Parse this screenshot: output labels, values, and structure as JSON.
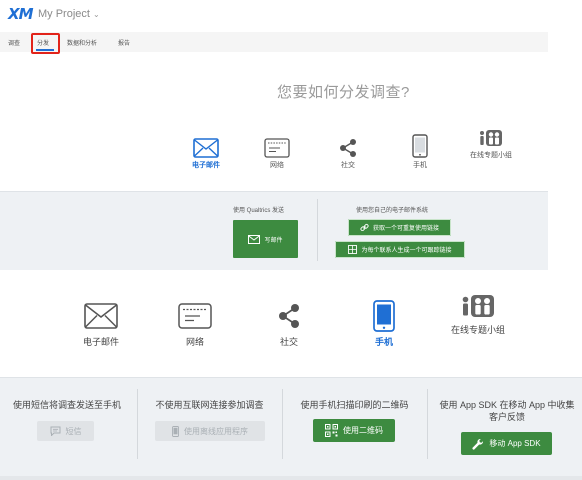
{
  "app": {
    "logo": "XM",
    "project": "My Project",
    "project_chevron": "⌄"
  },
  "nav": {
    "tabs": [
      {
        "label": "调查",
        "active": false
      },
      {
        "label": "分发",
        "active": true
      },
      {
        "label": "数据和分析",
        "active": false
      },
      {
        "label": "报告",
        "active": false
      }
    ]
  },
  "question": "您要如何分发调查?",
  "small_options": [
    {
      "label": "电子邮件",
      "icon": "envelope-icon",
      "active": true
    },
    {
      "label": "网络",
      "icon": "browser-window-icon",
      "active": false
    },
    {
      "label": "社交",
      "icon": "share-icon",
      "active": false
    },
    {
      "label": "手机",
      "icon": "mobile-phone-icon",
      "active": false
    },
    {
      "label": "在线专题小组",
      "icon": "panel-people-icon",
      "active": false
    }
  ],
  "email_panel": {
    "col1_title": "使用 Qualtrics 发送",
    "compose_button": "写邮件",
    "col2_title": "使用您自己的电子邮件系统",
    "reusable_link_button": "获取一个可重复使用链接",
    "personal_link_button": "为每个联系人生成一个可跟踪链接"
  },
  "big_options": [
    {
      "label": "电子邮件",
      "icon": "envelope-icon",
      "active": false
    },
    {
      "label": "网络",
      "icon": "browser-window-icon",
      "active": false
    },
    {
      "label": "社交",
      "icon": "share-icon",
      "active": false
    },
    {
      "label": "手机",
      "icon": "mobile-phone-icon",
      "active": true
    },
    {
      "label": "在线专题小组",
      "icon": "panel-people-icon",
      "active": false
    }
  ],
  "mobile_panel": {
    "col1_title": "使用短信将调查发送至手机",
    "sms_button": "短信",
    "col2_title": "不使用互联网连接参加调查",
    "offline_button": "使用离线应用程序",
    "col3_title": "使用手机扫描印刷的二维码",
    "qr_button": "使用二维码",
    "col4_title": "使用 App SDK 在移动 App 中收集客户反馈",
    "sdk_button": "移动 App SDK"
  },
  "colors": {
    "accent": "#1f6fd4",
    "green": "#3d8b40",
    "highlight": "#e2231a",
    "panel_bg": "#eef1f4"
  }
}
